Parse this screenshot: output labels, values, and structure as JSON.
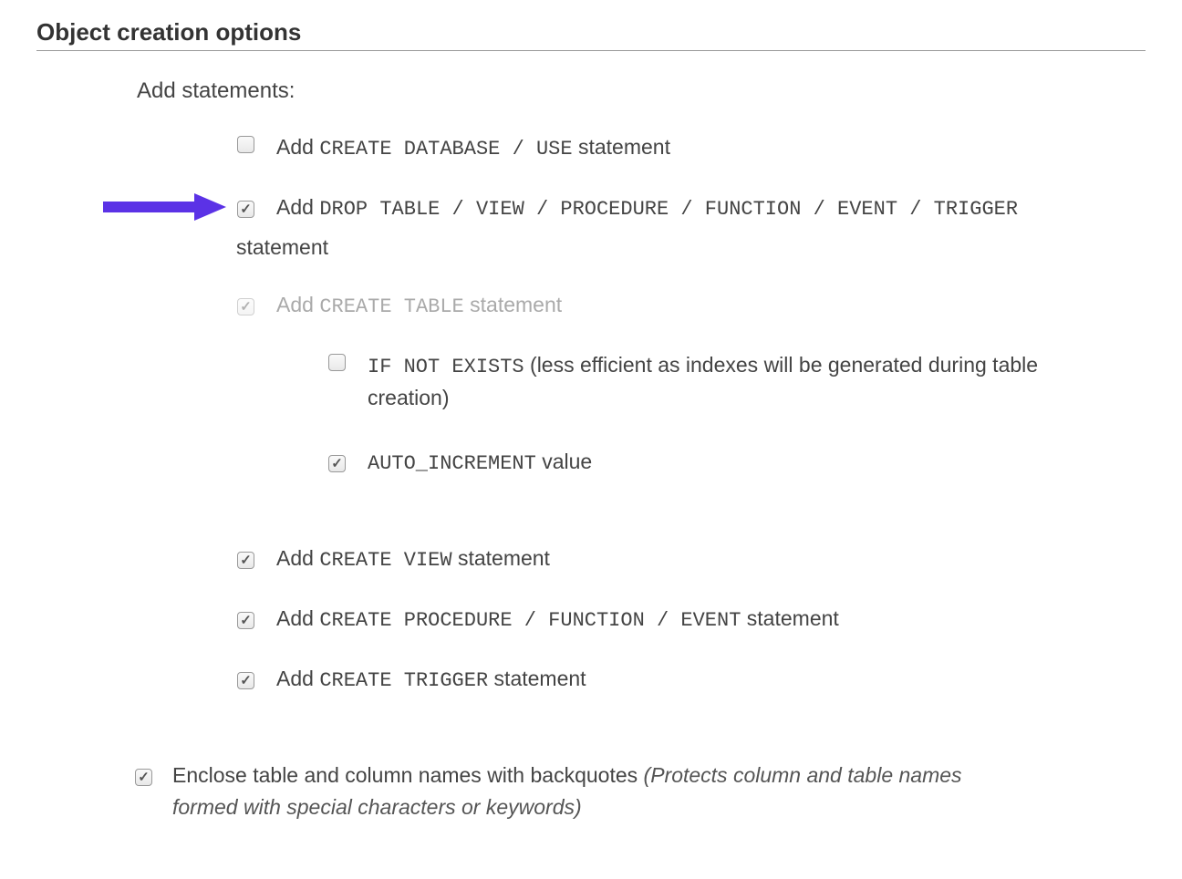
{
  "section": {
    "title": "Object creation options"
  },
  "group_heading": "Add statements:",
  "options": {
    "create_database": {
      "prefix": "Add ",
      "mono": "CREATE DATABASE / USE",
      "suffix": " statement",
      "checked": false,
      "disabled": false
    },
    "drop_table": {
      "prefix": "Add ",
      "mono": "DROP TABLE / VIEW / PROCEDURE / FUNCTION / EVENT / TRIGGER",
      "suffix_line2": "statement",
      "checked": true,
      "disabled": false
    },
    "create_table": {
      "prefix": "Add ",
      "mono": "CREATE TABLE",
      "suffix": " statement",
      "checked": true,
      "disabled": true
    },
    "if_not_exists": {
      "mono": "IF NOT EXISTS",
      "suffix": " (less efficient as indexes will be generated during table creation)",
      "checked": false,
      "disabled": false
    },
    "auto_increment": {
      "mono": "AUTO_INCREMENT",
      "suffix": " value",
      "checked": true,
      "disabled": false
    },
    "create_view": {
      "prefix": "Add ",
      "mono": "CREATE VIEW",
      "suffix": " statement",
      "checked": true,
      "disabled": false
    },
    "create_proc": {
      "prefix": "Add ",
      "mono": "CREATE PROCEDURE / FUNCTION / EVENT",
      "suffix": " statement",
      "checked": true,
      "disabled": false
    },
    "create_trigger": {
      "prefix": "Add ",
      "mono": "CREATE TRIGGER",
      "suffix": " statement",
      "checked": true,
      "disabled": false
    },
    "enclose_backquotes": {
      "text": "Enclose table and column names with backquotes ",
      "note": "(Protects column and table names formed with special characters or keywords)",
      "checked": true,
      "disabled": false
    }
  },
  "arrow_color": "#5b32e6"
}
